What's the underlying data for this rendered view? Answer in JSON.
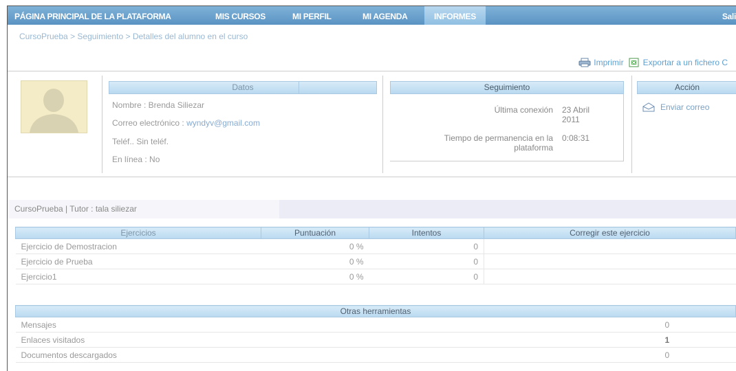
{
  "nav": {
    "items": [
      "PÁGINA PRINCIPAL DE LA PLATAFORMA",
      "MIS CURSOS",
      "MI PERFIL",
      "MI AGENDA",
      "INFORMES"
    ],
    "right": "Sali"
  },
  "breadcrumb": [
    "CursoPrueba",
    "Seguimiento",
    "Detalles del alumno en el curso"
  ],
  "toolbar": {
    "print": "Imprimir",
    "export": "Exportar a un fichero C"
  },
  "datos": {
    "header": "Datos",
    "nombre": "Nombre : Brenda Siliezar",
    "correo_label": "Correo electrónico :",
    "correo": "wyndyv@gmail.com",
    "telefono": "Teléf.. Sin teléf.",
    "en_linea": "En línea : No"
  },
  "seguimiento": {
    "header": "Seguimiento",
    "ultima_label": "Última conexión",
    "ultima_value": "23 Abril 2011",
    "tiempo_label": "Tiempo de permanencia en la plataforma",
    "tiempo_value": "0:08:31"
  },
  "accion": {
    "header": "Acción",
    "enviar": "Enviar correo"
  },
  "course": {
    "title": "CursoPrueba  |  Tutor : tala siliezar"
  },
  "ejercicios": {
    "headers": [
      "Ejercicios",
      "Puntuación",
      "Intentos",
      "Corregir este ejercicio"
    ],
    "rows": [
      [
        "Ejercicio de Demostracion",
        "0 %",
        "0"
      ],
      [
        "Ejercicio de Prueba",
        "0 %",
        "0"
      ],
      [
        "Ejercicio1",
        "0 %",
        "0"
      ]
    ]
  },
  "otras": {
    "header": "Otras herramientas",
    "rows": [
      [
        "Mensajes",
        "0"
      ],
      [
        "Enlaces visitados",
        "1"
      ],
      [
        "Documentos descargados",
        "0"
      ]
    ]
  }
}
